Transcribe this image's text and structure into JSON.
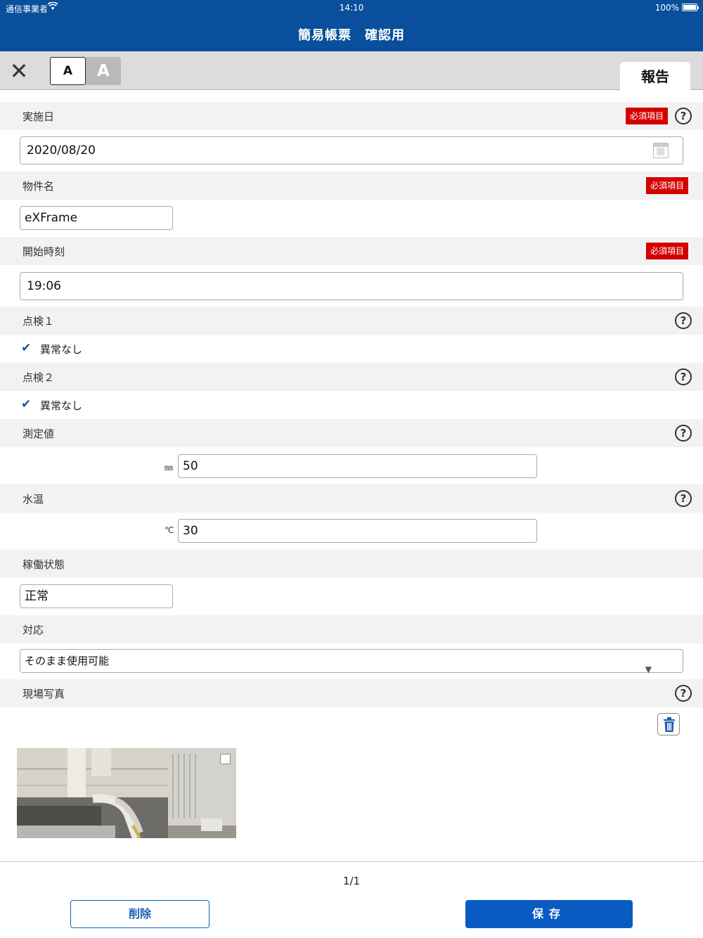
{
  "status_bar": {
    "carrier": "通信事業者",
    "time": "14:10",
    "battery": "100%"
  },
  "header": {
    "title": "簡易帳票　確認用"
  },
  "toolbar": {
    "close_glyph": "✕",
    "font_small": "A",
    "font_large": "A",
    "tab_report": "報告"
  },
  "required_label": "必須項目",
  "help_glyph": "?",
  "fields": {
    "date": {
      "label": "実施日",
      "value": "2020/08/20"
    },
    "property": {
      "label": "物件名",
      "value": "eXFrame"
    },
    "start_time": {
      "label": "開始時刻",
      "value": "19:06"
    },
    "check1": {
      "label": "点検１",
      "option": "異常なし",
      "checked": true
    },
    "check2": {
      "label": "点検２",
      "option": "異常なし",
      "checked": true
    },
    "measurement": {
      "label": "測定値",
      "unit": "㎜",
      "value": "50"
    },
    "water_temp": {
      "label": "水温",
      "unit": "℃",
      "value": "30"
    },
    "operation": {
      "label": "稼働状態",
      "value": "正常"
    },
    "response": {
      "label": "対応",
      "value": "そのまま使用可能"
    },
    "photo": {
      "label": "現場写真"
    }
  },
  "check_glyph": "✔",
  "pager": "1/1",
  "footer": {
    "delete": "削除",
    "save": "保存"
  }
}
